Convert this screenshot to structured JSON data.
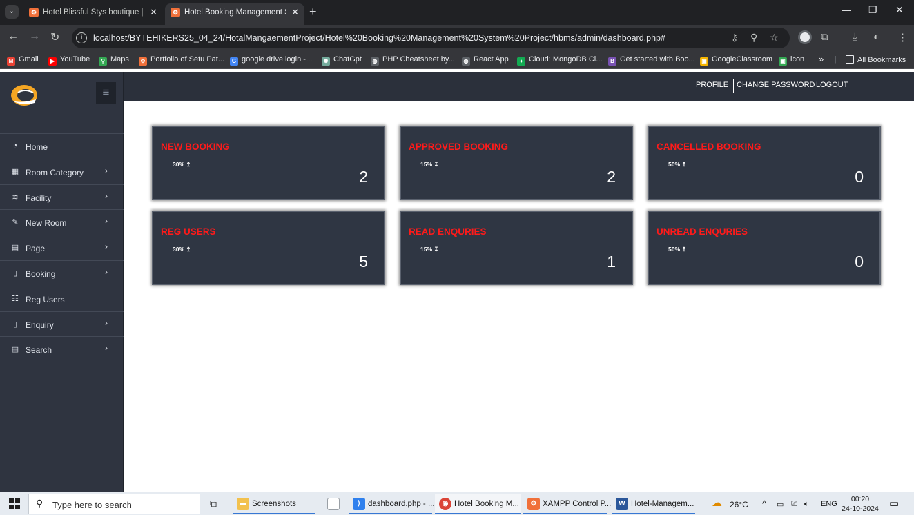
{
  "browser": {
    "tabs": [
      {
        "title": "Hotel Blissful Stys boutique | H",
        "active": false
      },
      {
        "title": "Hotel Booking Management Sy",
        "active": true
      }
    ],
    "url": "localhost/BYTEHIKERS25_04_24/HotalMangaementProject/Hotel%20Booking%20Management%20System%20Project/hbms/admin/dashboard.php#",
    "bookmarks": [
      {
        "label": "Gmail",
        "color": "#ea4335",
        "glyph": "M"
      },
      {
        "label": "YouTube",
        "color": "#ff0000",
        "glyph": "▶"
      },
      {
        "label": "Maps",
        "color": "#34a853",
        "glyph": "⚲"
      },
      {
        "label": "Portfolio of Setu Pat...",
        "color": "#f0703a",
        "glyph": "⚙"
      },
      {
        "label": "google drive login -...",
        "color": "#4285f4",
        "glyph": "G"
      },
      {
        "label": "ChatGpt",
        "color": "#74aa9c",
        "glyph": "✺"
      },
      {
        "label": "PHP Cheatsheet by...",
        "color": "#5f6368",
        "glyph": "◍"
      },
      {
        "label": "React App",
        "color": "#5f6368",
        "glyph": "◍"
      },
      {
        "label": "Cloud: MongoDB Cl...",
        "color": "#13aa52",
        "glyph": "♦"
      },
      {
        "label": "Get started with Boo...",
        "color": "#7952b3",
        "glyph": "B"
      },
      {
        "label": "GoogleClassroom",
        "color": "#f4b400",
        "glyph": "▣"
      },
      {
        "label": "icon",
        "color": "#34a853",
        "glyph": "▣"
      }
    ],
    "all_bookmarks": "All Bookmarks"
  },
  "app": {
    "header_links": [
      "PROFILE",
      "CHANGE PASSWORD",
      "LOGOUT"
    ],
    "menu": [
      {
        "label": "Home",
        "icon": "dashboard-icon",
        "glyph": "◔",
        "chevron": false
      },
      {
        "label": "Room Category",
        "icon": "table-icon",
        "glyph": "▦",
        "chevron": true
      },
      {
        "label": "Facility",
        "icon": "layers-icon",
        "glyph": "≋",
        "chevron": true
      },
      {
        "label": "New Room",
        "icon": "pencil-icon",
        "glyph": "✎",
        "chevron": true
      },
      {
        "label": "Page",
        "icon": "file-icon",
        "glyph": "▤",
        "chevron": true
      },
      {
        "label": "Booking",
        "icon": "book-icon",
        "glyph": "▯",
        "chevron": true
      },
      {
        "label": "Reg Users",
        "icon": "users-icon",
        "glyph": "☷",
        "chevron": false
      },
      {
        "label": "Enquiry",
        "icon": "book-icon",
        "glyph": "▯",
        "chevron": true
      },
      {
        "label": "Search",
        "icon": "file-icon",
        "glyph": "▤",
        "chevron": true
      }
    ],
    "cards": [
      {
        "title": "NEW BOOKING",
        "percent": "30%",
        "trend": "↥",
        "value": "2"
      },
      {
        "title": "APPROVED BOOKING",
        "percent": "15%",
        "trend": "↧",
        "value": "2"
      },
      {
        "title": "CANCELLED BOOKING",
        "percent": "50%",
        "trend": "↥",
        "value": "0"
      },
      {
        "title": "REG USERS",
        "percent": "30%",
        "trend": "↥",
        "value": "5"
      },
      {
        "title": "READ ENQURIES",
        "percent": "15%",
        "trend": "↧",
        "value": "1"
      },
      {
        "title": "UNREAD ENQURIES",
        "percent": "50%",
        "trend": "↥",
        "value": "0"
      }
    ],
    "title_color": "#ff1a1a"
  },
  "taskbar": {
    "search_placeholder": "Type here to search",
    "apps": [
      {
        "label": "Screenshots",
        "color": "#f2c14e",
        "glyph": "▬"
      },
      {
        "label": "dashboard.php - ...",
        "color": "#2f80ed",
        "glyph": "⟩"
      },
      {
        "label": "Hotel Booking M...",
        "color": "#db4437",
        "glyph": "◉"
      },
      {
        "label": "XAMPP Control P...",
        "color": "#f0703a",
        "glyph": "⚙"
      },
      {
        "label": "Hotel-Managem...",
        "color": "#2b579a",
        "glyph": "W"
      }
    ],
    "weather": "26°C",
    "language": "ENG",
    "time": "00:20",
    "date": "24-10-2024"
  }
}
